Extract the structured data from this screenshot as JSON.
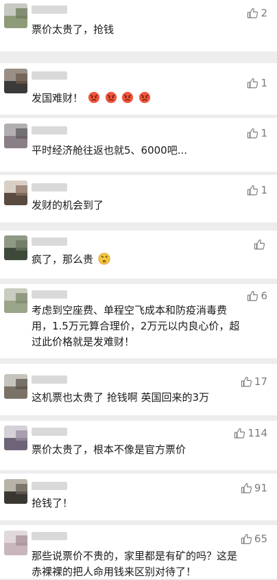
{
  "icons": {
    "like": "thumbs-up-icon",
    "angry": "angry-face-emoji",
    "dizzy": "dizzy-face-emoji"
  },
  "colors": {
    "background": "#ededed",
    "card": "#ffffff",
    "text": "#1a1a1a",
    "like": "#7a7a7a"
  },
  "comments": [
    {
      "line1": "票价太贵了，抢钱",
      "line2": "",
      "line3": "",
      "likes": "2"
    },
    {
      "line1": "发国难财！",
      "line2": "",
      "line3": "",
      "likes": "1",
      "emoji": "angry-face-emoji x4"
    },
    {
      "line1": "平时经济舱往返也就5、6000吧...",
      "line2": "",
      "line3": "",
      "likes": "1"
    },
    {
      "line1": "发财的机会到了",
      "line2": "",
      "line3": "",
      "likes": "1"
    },
    {
      "line1": "疯了，那么贵",
      "line2": "",
      "line3": "",
      "likes": "",
      "emoji": "dizzy-face-emoji"
    },
    {
      "line1": "考虑到空座费、单程空飞成本和防疫消毒费",
      "line2": "用，1.5万元算合理价，2万元以内良心价，超",
      "line3": "过此价格就是发难财！",
      "likes": "6"
    },
    {
      "line1": "这机票也太贵了  抢钱啊  英国回来的3万",
      "line2": "",
      "line3": "",
      "likes": "17"
    },
    {
      "line1": "票价太贵了，根本不像是官方票价",
      "line2": "",
      "line3": "",
      "likes": "114"
    },
    {
      "line1": "抢钱了！",
      "line2": "",
      "line3": "",
      "likes": "91"
    },
    {
      "line1": "那些说票价不贵的，家里都是有矿的吗？这是",
      "line2": "赤裸裸的把人命用钱来区别对待了！",
      "line3": "",
      "likes": "65"
    }
  ]
}
